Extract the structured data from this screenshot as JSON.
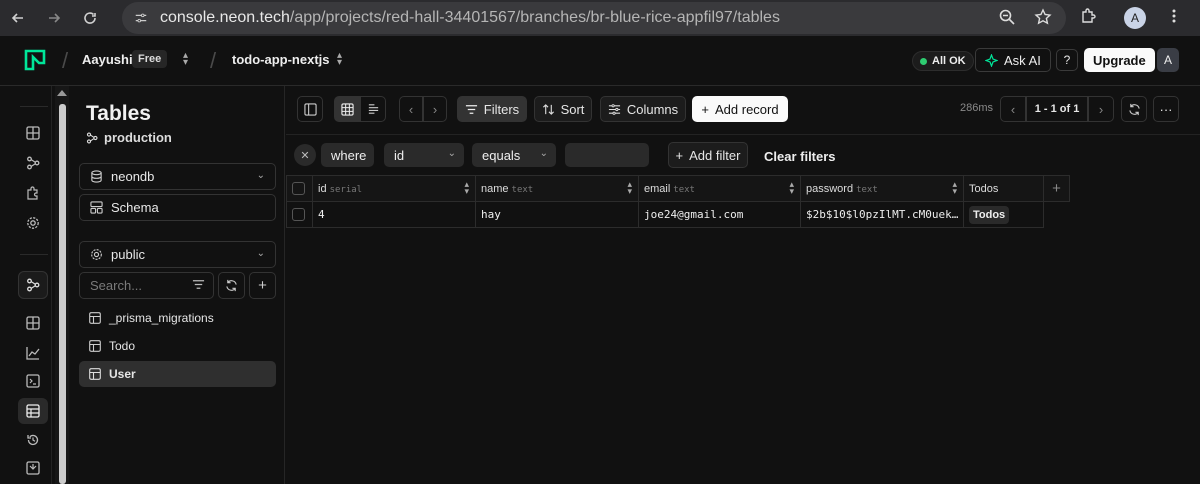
{
  "browser": {
    "url_host": "console.neon.tech",
    "url_path": "/app/projects/red-hall-34401567/branches/br-blue-rice-appfil97/tables",
    "profile_initial": "A"
  },
  "topbar": {
    "org_name": "Aayushi",
    "plan_badge": "Free",
    "project_name": "todo-app-nextjs",
    "status": "All OK",
    "ask_ai": "Ask AI",
    "help": "?",
    "upgrade": "Upgrade",
    "user_initial": "A",
    "accent_color": "#00e599"
  },
  "sidebar": {
    "title": "Tables",
    "branch": "production",
    "database": "neondb",
    "schema_button": "Schema",
    "schema_select": "public",
    "search_placeholder": "Search...",
    "tables": [
      {
        "label": "_prisma_migrations",
        "selected": false
      },
      {
        "label": "Todo",
        "selected": false
      },
      {
        "label": "User",
        "selected": true
      }
    ]
  },
  "toolbar": {
    "filters": "Filters",
    "sort": "Sort",
    "columns": "Columns",
    "add_record": "Add record",
    "timing": "286ms",
    "pagination": "1 - 1 of 1"
  },
  "filter": {
    "where": "where",
    "column": "id",
    "operator": "equals",
    "value": "",
    "add_filter": "Add filter",
    "clear_filters": "Clear filters"
  },
  "table": {
    "columns": [
      {
        "name": "id",
        "type": "serial"
      },
      {
        "name": "name",
        "type": "text"
      },
      {
        "name": "email",
        "type": "text"
      },
      {
        "name": "password",
        "type": "text"
      },
      {
        "name": "Todos",
        "type": ""
      }
    ],
    "rows": [
      {
        "id": "4",
        "name": "hay",
        "email": "joe24@gmail.com",
        "password": "$2b$10$l0pzIlMT.cM0uek…",
        "todos": "Todos"
      }
    ]
  }
}
